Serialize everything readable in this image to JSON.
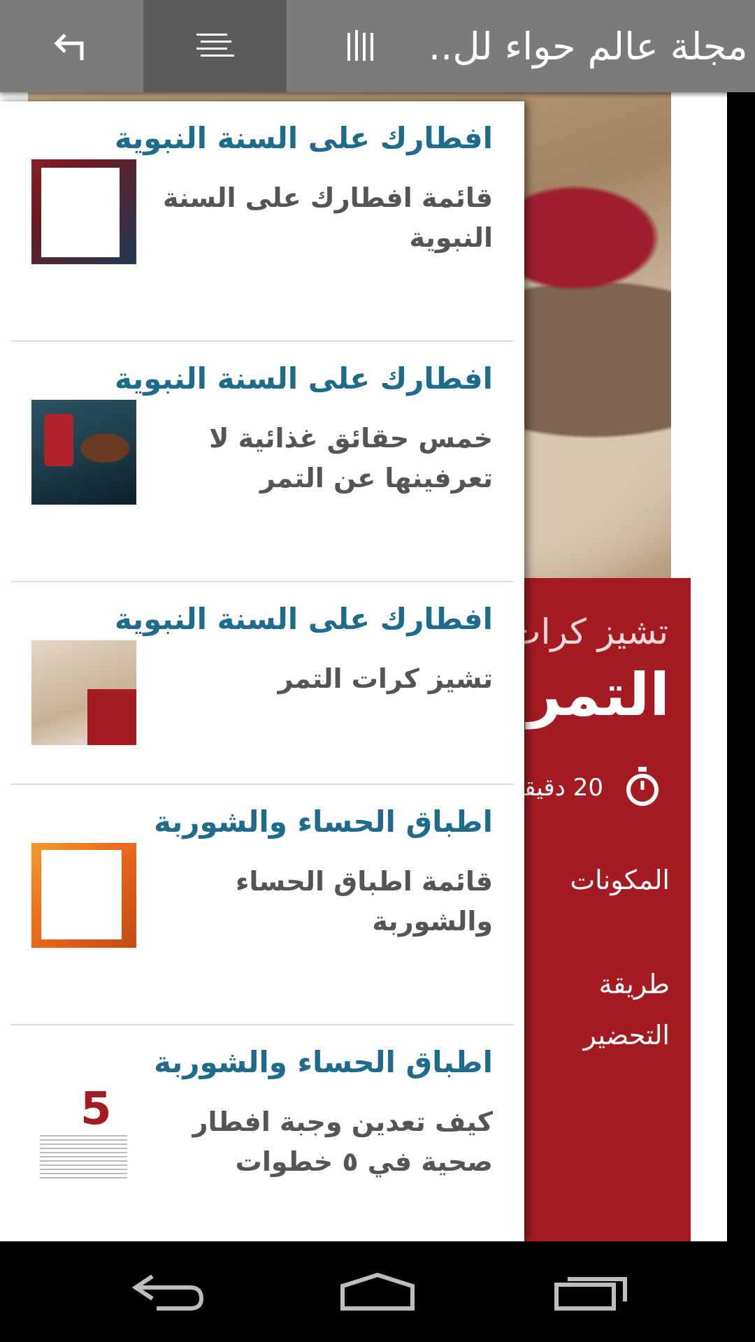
{
  "topbar": {
    "title": "مجلة عالم حواء لل..",
    "back_icon": "back-arrow-icon",
    "menu_icon": "list-icon",
    "pages_icon": "pages-icon"
  },
  "drawer": {
    "items": [
      {
        "title": "افطارك على السنة النبوية",
        "subtitle": "قائمة افطارك على السنة النبوية"
      },
      {
        "title": "افطارك على السنة النبوية",
        "subtitle": "خمس حقائق غذائية لا تعرفينها عن التمر"
      },
      {
        "title": "افطارك على السنة النبوية",
        "subtitle": "تشيز كرات التمر"
      },
      {
        "title": "اطباق الحساء والشوربة",
        "subtitle": "قائمة اطباق الحساء والشوربة"
      },
      {
        "title": "اطباق الحساء والشوربة",
        "subtitle": "كيف تعدين وجبة افطار صحية في ٥ خطوات"
      }
    ]
  },
  "recipe_page": {
    "subtitle": "تشيز كرات",
    "title": "التمر",
    "time": "20 دقيقة",
    "ingredients": "المكونات",
    "method": "طريقة التحضير",
    "accent_color": "#a41b22"
  },
  "navbar": {
    "back_icon": "nav-back-icon",
    "home_icon": "nav-home-icon",
    "recents_icon": "nav-recents-icon"
  }
}
